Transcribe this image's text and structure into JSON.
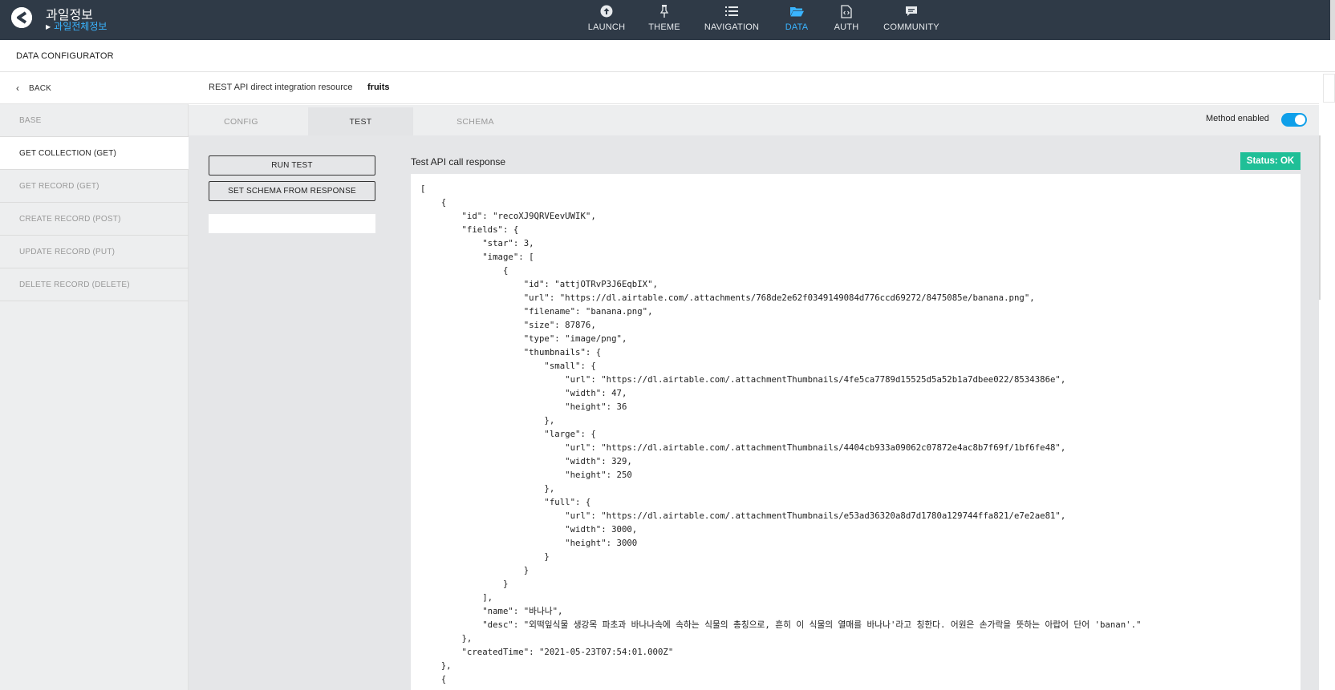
{
  "app": {
    "title": "과일정보",
    "subtitle": "과일전체정보",
    "logo_icon": "app-logo-icon"
  },
  "nav": [
    {
      "label": "LAUNCH",
      "icon": "launch-icon"
    },
    {
      "label": "THEME",
      "icon": "theme-pin-icon"
    },
    {
      "label": "NAVIGATION",
      "icon": "navigation-list-icon"
    },
    {
      "label": "DATA",
      "icon": "folder-icon",
      "active": true
    },
    {
      "label": "AUTH",
      "icon": "auth-file-icon"
    },
    {
      "label": "COMMUNITY",
      "icon": "chat-icon"
    }
  ],
  "header": {
    "title": "DATA CONFIGURATOR"
  },
  "sidebar": {
    "back_label": "BACK",
    "items": [
      {
        "label": "BASE"
      },
      {
        "label": "GET COLLECTION (GET)",
        "active": true
      },
      {
        "label": "GET RECORD (GET)"
      },
      {
        "label": "CREATE RECORD (POST)"
      },
      {
        "label": "UPDATE RECORD (PUT)"
      },
      {
        "label": "DELETE RECORD (DELETE)"
      }
    ]
  },
  "resource": {
    "label": "REST API direct integration resource",
    "name": "fruits"
  },
  "tabs": [
    {
      "label": "CONFIG"
    },
    {
      "label": "TEST",
      "active": true
    },
    {
      "label": "SCHEMA"
    }
  ],
  "method_enabled": {
    "label": "Method enabled",
    "on": true
  },
  "actions": {
    "run_test": "RUN TEST",
    "set_schema": "SET SCHEMA FROM RESPONSE"
  },
  "response": {
    "title": "Test API call response",
    "status": "Status: OK",
    "lines": [
      "[",
      "    {",
      "        \"id\": \"recoXJ9QRVEevUWIK\",",
      "        \"fields\": {",
      "            \"star\": 3,",
      "            \"image\": [",
      "                {",
      "                    \"id\": \"attjOTRvP3J6EqbIX\",",
      "                    \"url\": \"https://dl.airtable.com/.attachments/768de2e62f0349149084d776ccd69272/8475085e/banana.png\",",
      "                    \"filename\": \"banana.png\",",
      "                    \"size\": 87876,",
      "                    \"type\": \"image/png\",",
      "                    \"thumbnails\": {",
      "                        \"small\": {",
      "                            \"url\": \"https://dl.airtable.com/.attachmentThumbnails/4fe5ca7789d15525d5a52b1a7dbee022/8534386e\",",
      "                            \"width\": 47,",
      "                            \"height\": 36",
      "                        },",
      "                        \"large\": {",
      "                            \"url\": \"https://dl.airtable.com/.attachmentThumbnails/4404cb933a09062c07872e4ac8b7f69f/1bf6fe48\",",
      "                            \"width\": 329,",
      "                            \"height\": 250",
      "                        },",
      "                        \"full\": {",
      "                            \"url\": \"https://dl.airtable.com/.attachmentThumbnails/e53ad36320a8d7d1780a129744ffa821/e7e2ae81\",",
      "                            \"width\": 3000,",
      "                            \"height\": 3000",
      "                        }",
      "                    }",
      "                }",
      "            ],",
      "            \"name\": \"바나나\",",
      "            \"desc\": \"외떡잎식물 생강목 파초과 바나나속에 속하는 식물의 총칭으로, 흔히 이 식물의 열매를 바나나'라고 칭한다. 어원은 손가락을 뜻하는 아랍어 단어 'banan'.\"",
      "        },",
      "        \"createdTime\": \"2021-05-23T07:54:01.000Z\"",
      "    },",
      "    {"
    ]
  },
  "colors": {
    "topbar": "#2f3a47",
    "accent": "#3ab4ff",
    "toggle": "#0f9fe9",
    "status_ok": "#1fbf97"
  }
}
